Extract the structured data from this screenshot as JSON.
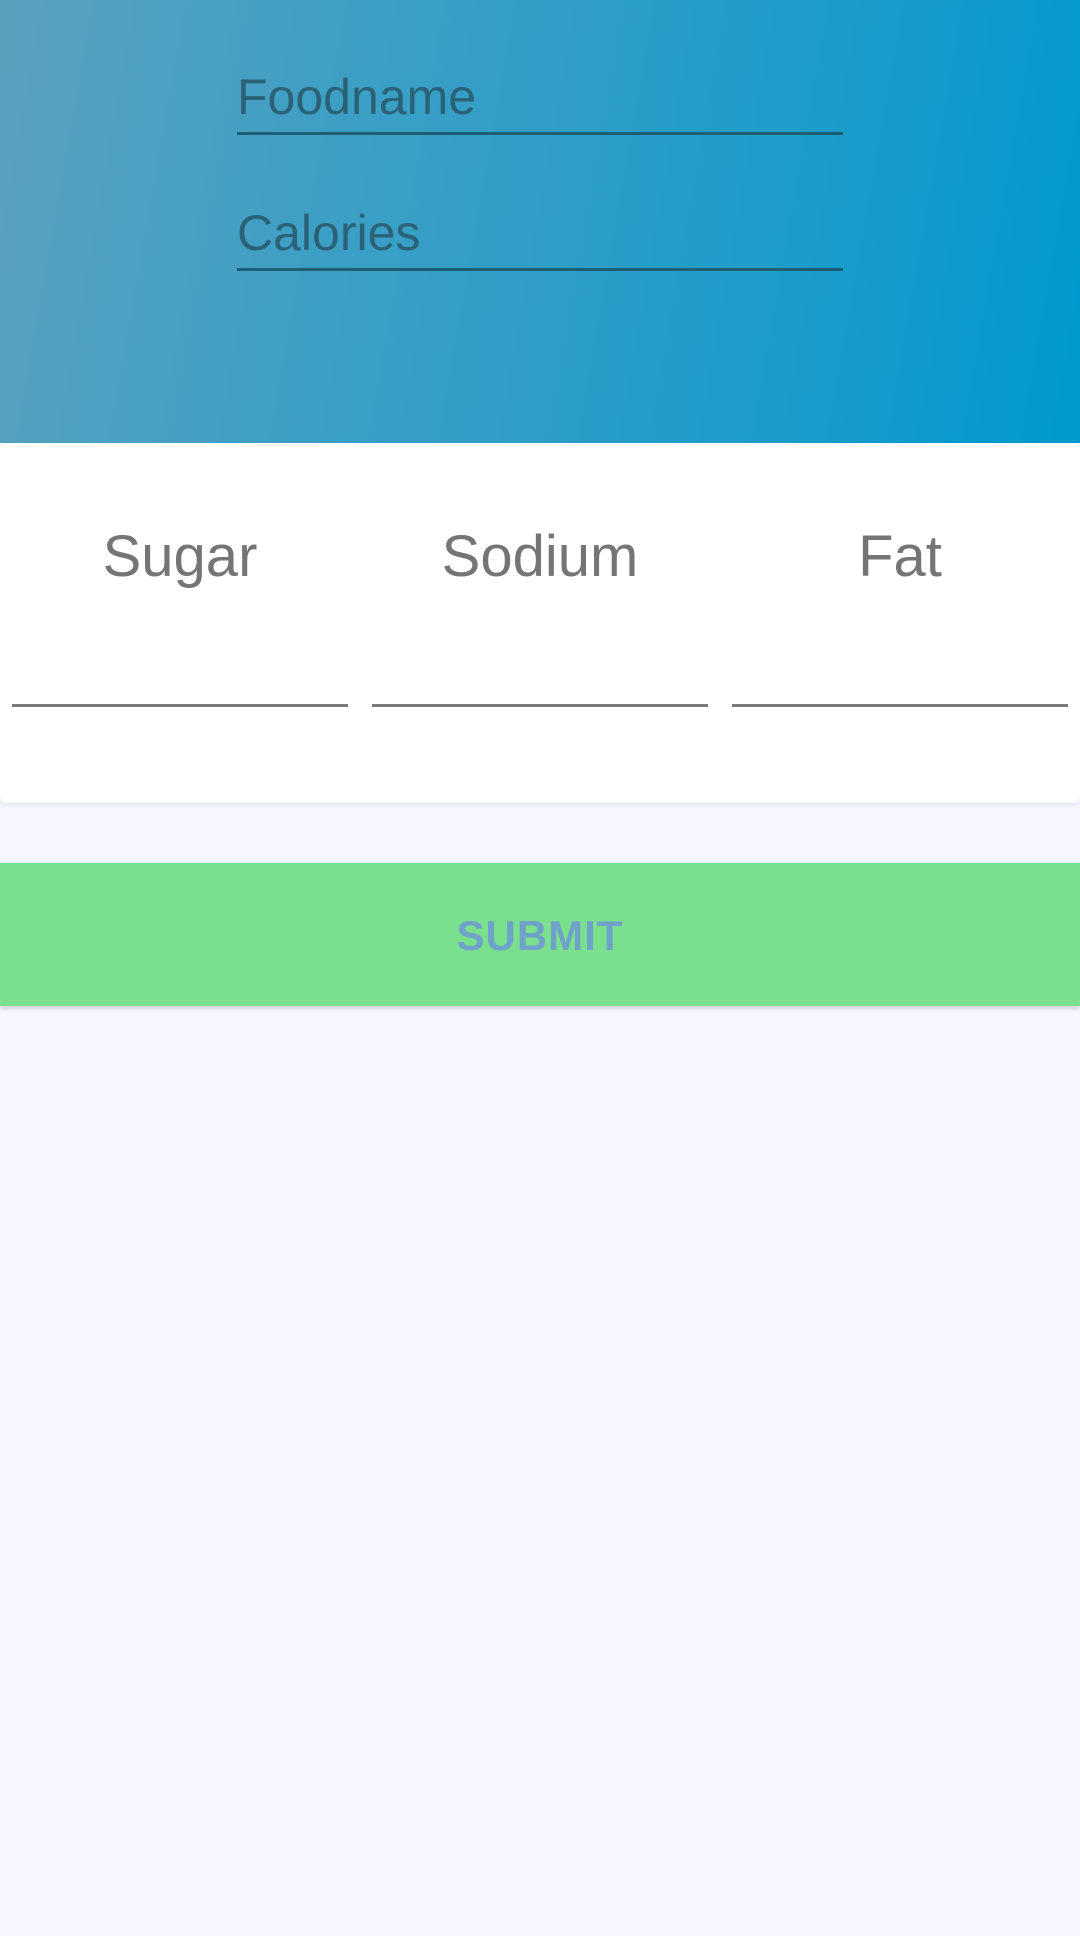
{
  "form": {
    "foodname": {
      "value": "",
      "placeholder": "Foodname"
    },
    "calories": {
      "value": "",
      "placeholder": "Calories"
    }
  },
  "nutrients": {
    "sugar": {
      "label": "Sugar",
      "value": ""
    },
    "sodium": {
      "label": "Sodium",
      "value": ""
    },
    "fat": {
      "label": "Fat",
      "value": ""
    }
  },
  "actions": {
    "submit_label": "SUBMIT"
  },
  "colors": {
    "header_gradient_start": "#5aa0bd",
    "header_gradient_end": "#009ace",
    "submit_bg": "#7be08e",
    "submit_text": "#6fa2c8",
    "page_bg": "#f5f6fe"
  }
}
